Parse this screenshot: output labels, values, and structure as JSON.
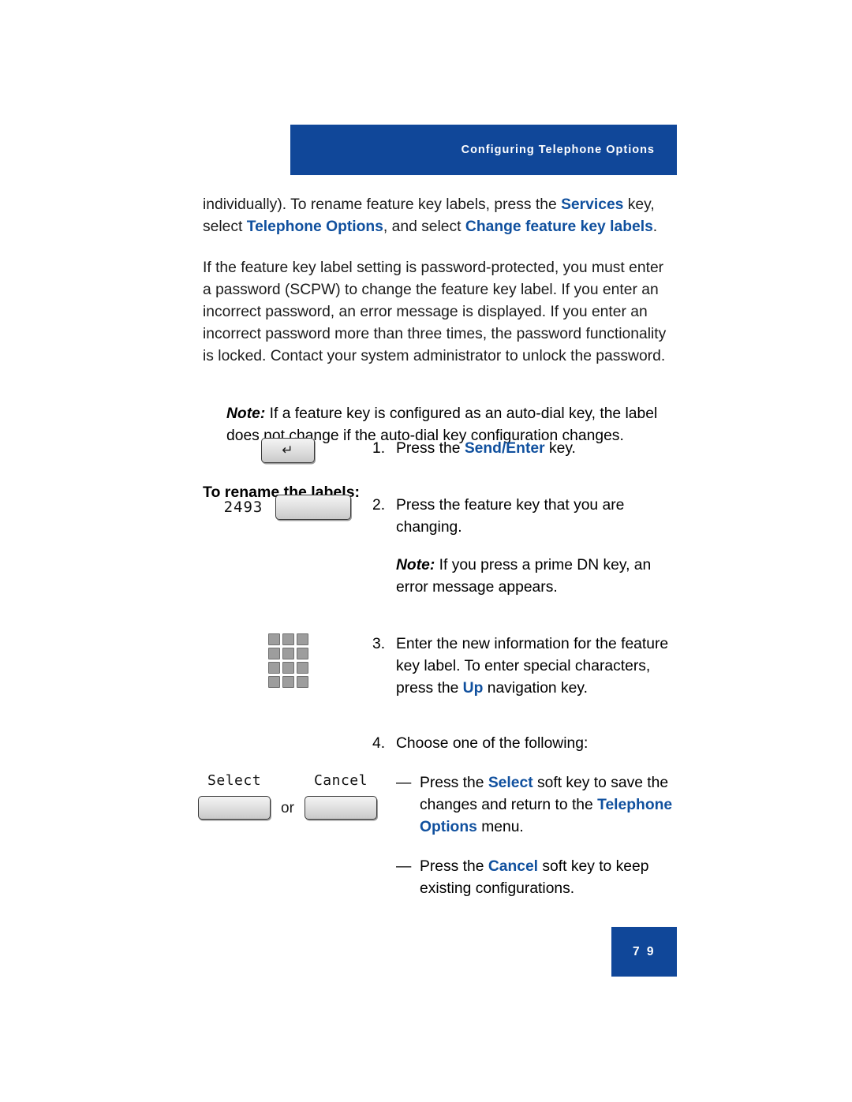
{
  "header": {
    "title": "Configuring Telephone Options"
  },
  "colors": {
    "accent": "#10509e",
    "band": "#104799"
  },
  "intro": {
    "para1_a": "individually). To rename feature key labels, press the ",
    "para1_services": "Services",
    "para1_b": " key,",
    "para1_c": "select ",
    "para1_telephone_options": "Telephone Options",
    "para1_d": ", and select ",
    "para1_change_labels": "Change feature key labels",
    "para1_e": ".",
    "para2": "If the feature key label setting is password-protected, you must enter a password (SCPW) to change the feature key label. If you enter an incorrect password, an error message is displayed. If you enter an incorrect password more than three times, the password functionality is locked. Contact your system administrator to unlock the password.",
    "note_lead": "Note:",
    "note_text": " If a feature key is configured as an auto-dial key, the label does not change if the auto-dial key configuration changes."
  },
  "subhead": "To rename the labels:",
  "steps": [
    {
      "number": "1.",
      "text_a": "Press the ",
      "highlight": "Send/Enter",
      "text_b": " key.",
      "icon": "send-enter-key-icon"
    },
    {
      "number": "2.",
      "text_a": "Press the feature key that you are changing.",
      "note_lead": "Note:",
      "note_text": " If you press a prime DN key, an error message appears.",
      "dn_label": "2493",
      "icon": "feature-key-icon"
    },
    {
      "number": "3.",
      "text_a": "Enter the new information for the feature key label. To enter special characters, press the ",
      "highlight": "Up",
      "text_b": " navigation key.",
      "icon": "dialpad-icon"
    },
    {
      "number": "4.",
      "text_a": "Choose one of the following:",
      "bullets": [
        {
          "dash": "—",
          "text_a": "Press the ",
          "highlight1": "Select",
          "text_b": " soft key to save the changes and return to the ",
          "highlight2": "Telephone Options",
          "text_c": " menu."
        },
        {
          "dash": "—",
          "text_a": "Press the ",
          "highlight1": "Cancel",
          "text_b": " soft key to keep existing configurations."
        }
      ],
      "softkeys": {
        "select_label": "Select",
        "cancel_label": "Cancel",
        "or": "or"
      }
    }
  ],
  "footer": {
    "page_number": "7 9"
  }
}
